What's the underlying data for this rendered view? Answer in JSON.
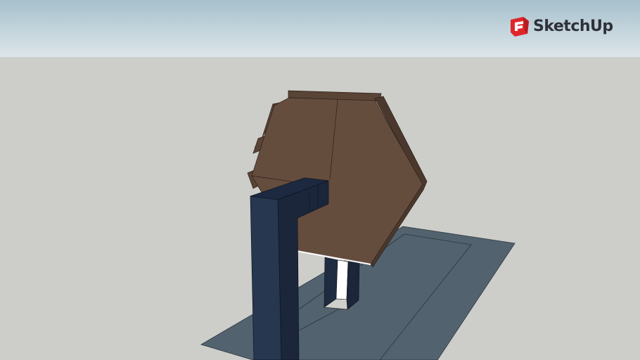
{
  "brand": {
    "name": "SketchUp"
  },
  "colors": {
    "roof": "#654d3e",
    "roof_edge": "#4b382d",
    "column": "#253550",
    "column_side": "#1b263a",
    "ground_plane": "#52626e"
  }
}
